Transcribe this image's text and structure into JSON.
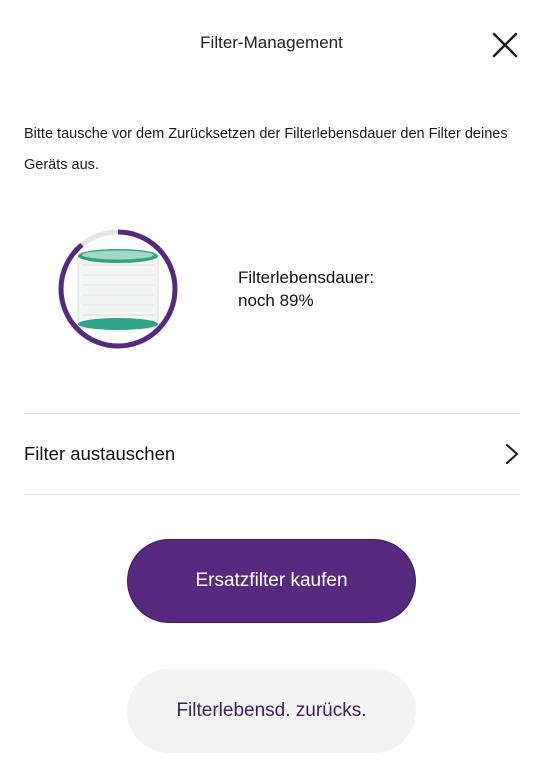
{
  "header": {
    "title": "Filter-Management"
  },
  "instruction": "Bitte tausche vor dem Zurücksetzen der Filterlebensdauer den Filter deines Geräts aus.",
  "filter_life": {
    "label": "Filterlebensdauer:",
    "value_text": "noch 89%",
    "remaining_fraction": 0.89
  },
  "replace_filter": {
    "label": "Filter austauschen"
  },
  "buttons": {
    "buy_label": "Ersatzfilter kaufen",
    "reset_label": "Filterlebensd. zurücks."
  },
  "colors": {
    "accent_purple": "#56297f",
    "filter_green": "#2ea38a",
    "ring_track": "#e4e4e4"
  },
  "icons": {
    "close": "close-icon",
    "chevron": "chevron-right-icon"
  }
}
